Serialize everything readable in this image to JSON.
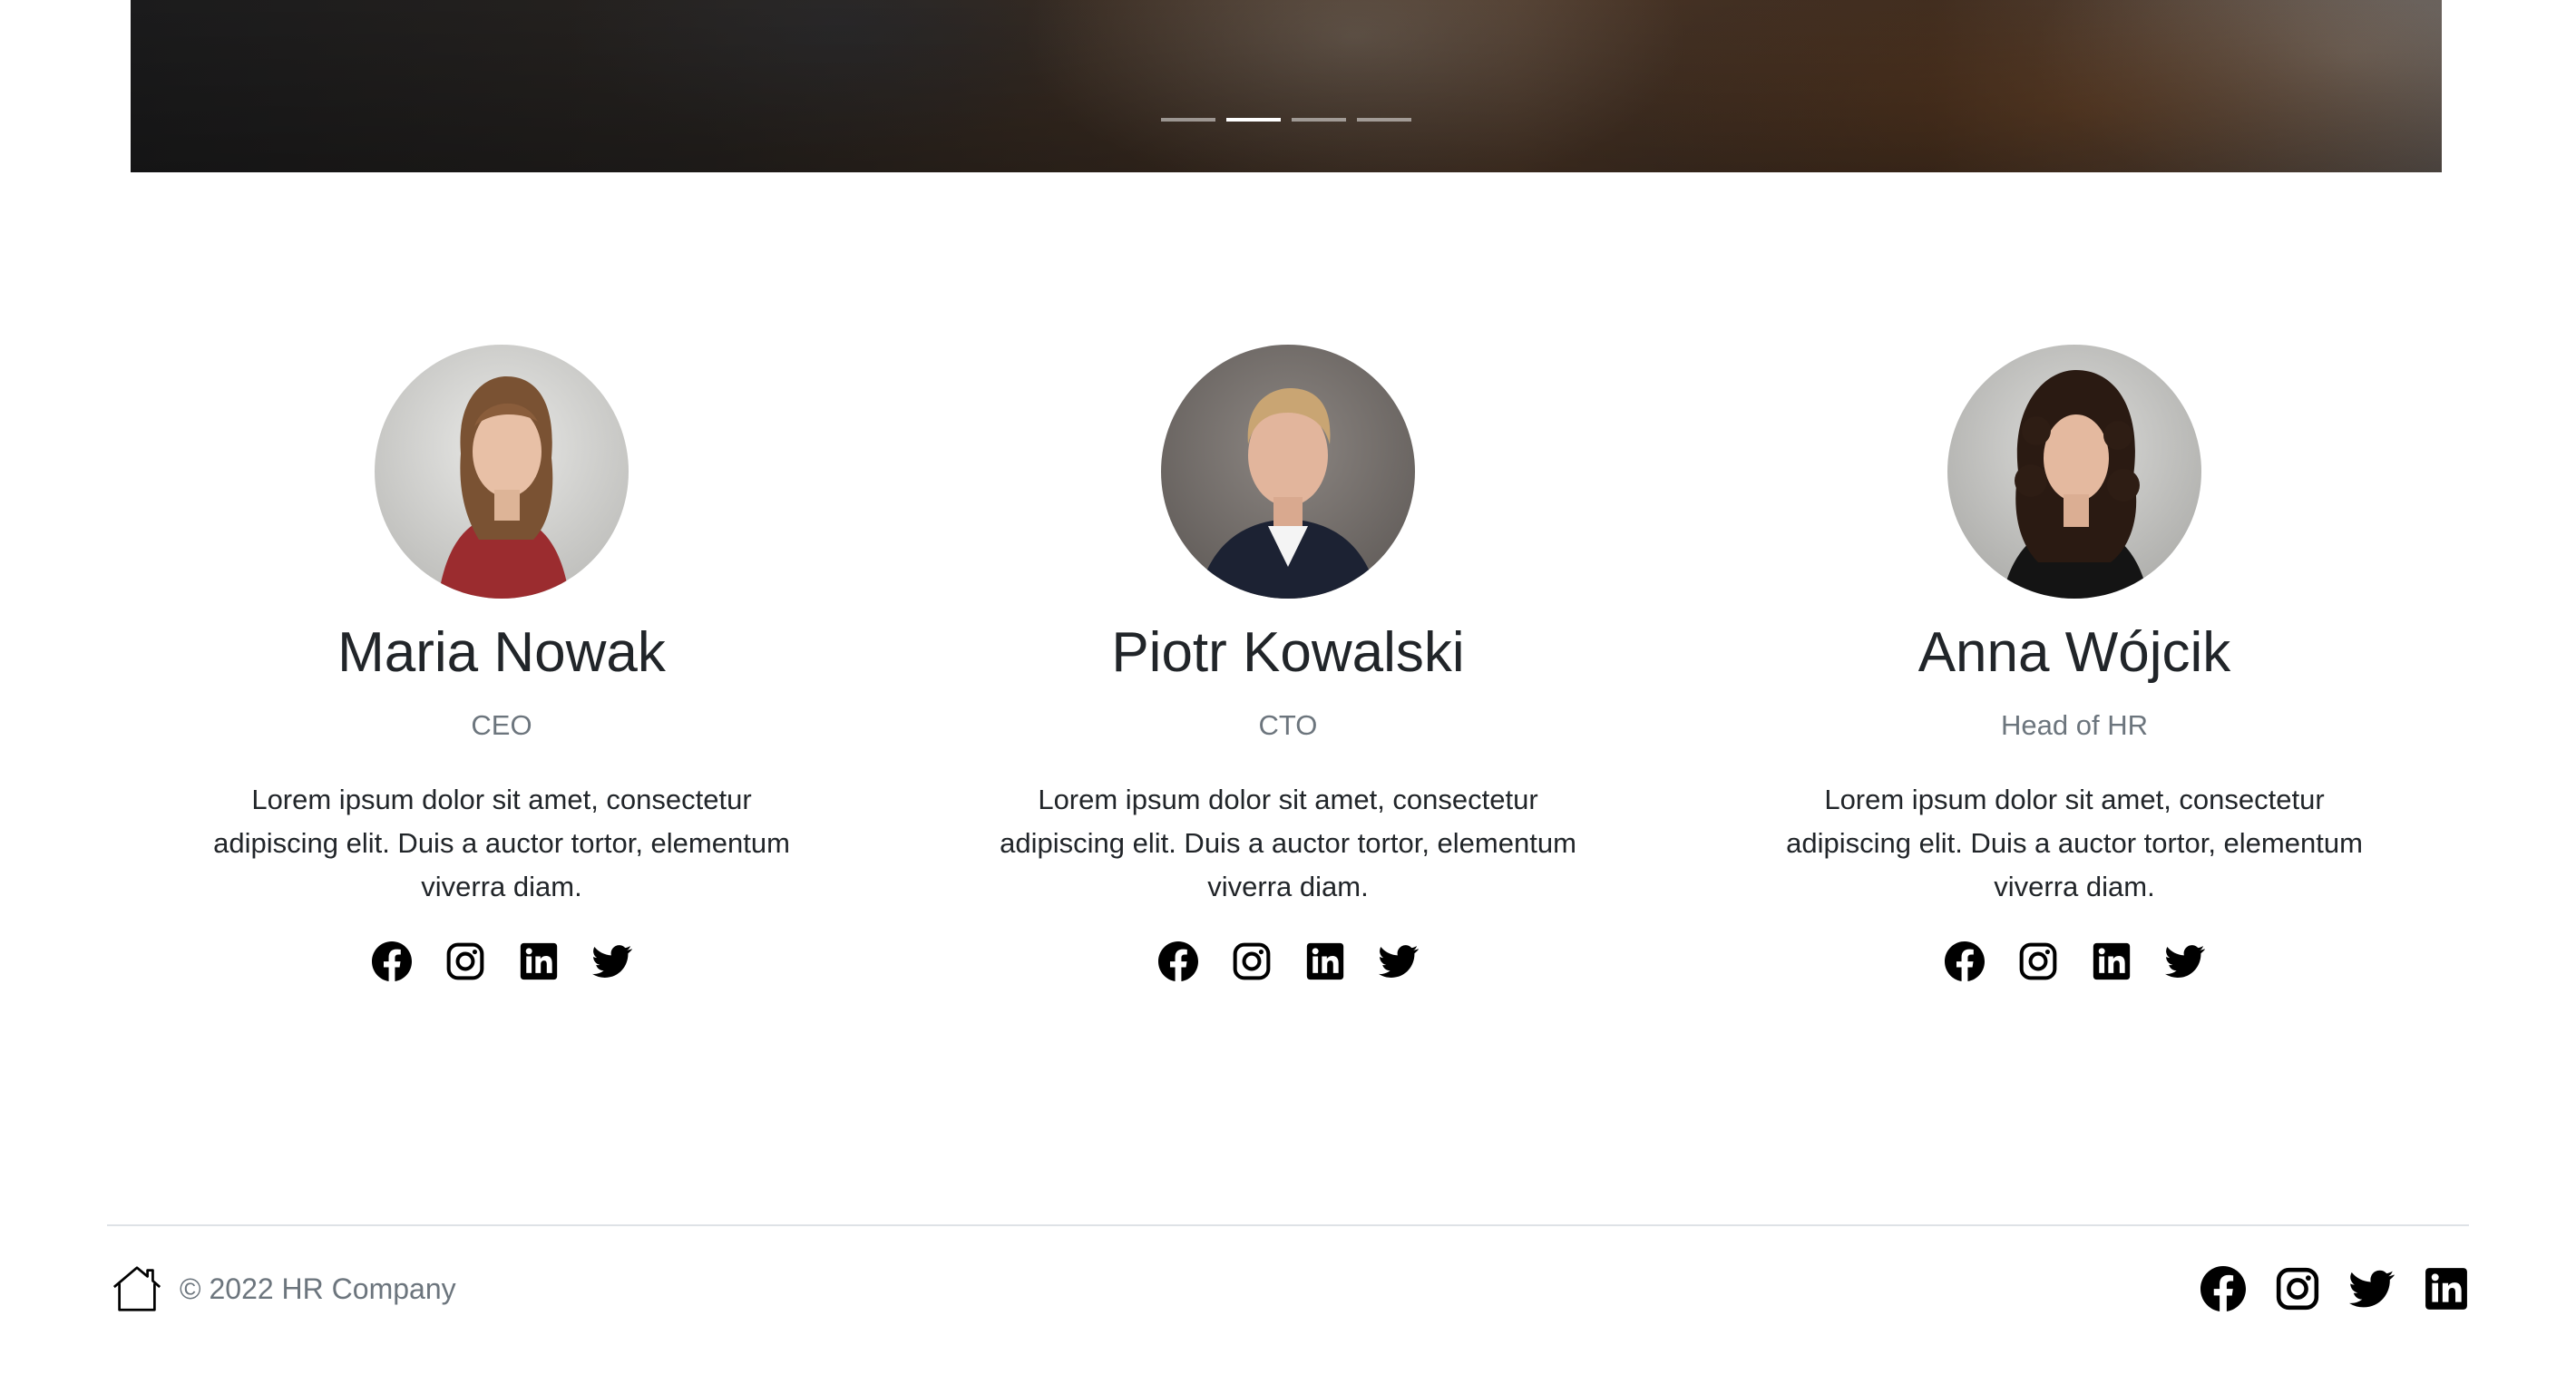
{
  "carousel": {
    "slides": [
      "slide-1",
      "slide-2",
      "slide-3",
      "slide-4"
    ],
    "active_index": 1
  },
  "team": [
    {
      "name": "Maria Nowak",
      "role": "CEO",
      "bio": "Lorem ipsum dolor sit amet, consectetur adipiscing elit. Duis a auctor tortor, elementum viverra diam.",
      "social": [
        "facebook-icon",
        "instagram-icon",
        "linkedin-icon",
        "twitter-icon"
      ]
    },
    {
      "name": "Piotr Kowalski",
      "role": "CTO",
      "bio": "Lorem ipsum dolor sit amet, consectetur adipiscing elit. Duis a auctor tortor, elementum viverra diam.",
      "social": [
        "facebook-icon",
        "instagram-icon",
        "linkedin-icon",
        "twitter-icon"
      ]
    },
    {
      "name": "Anna Wójcik",
      "role": "Head of HR",
      "bio": "Lorem ipsum dolor sit amet, consectetur adipiscing elit. Duis a auctor tortor, elementum viverra diam.",
      "social": [
        "facebook-icon",
        "instagram-icon",
        "linkedin-icon",
        "twitter-icon"
      ]
    }
  ],
  "footer": {
    "copyright": "© 2022 HR Company",
    "home_icon": "home-icon",
    "social": [
      "facebook-icon",
      "instagram-icon",
      "twitter-icon",
      "linkedin-icon"
    ]
  },
  "colors": {
    "text_primary": "#212529",
    "text_muted": "#6c757d",
    "divider": "#dee2e6",
    "icon": "#000000"
  }
}
